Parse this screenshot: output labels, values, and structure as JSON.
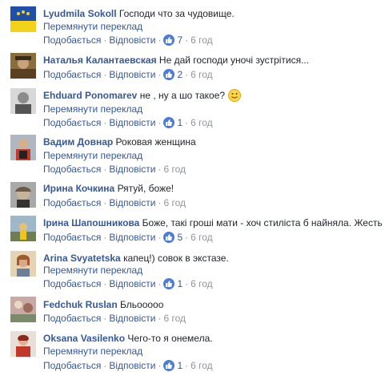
{
  "ui": {
    "like": "Подобається",
    "reply": "Відповісти",
    "translate": "Перемянути переклад",
    "dot": "·"
  },
  "comments": [
    {
      "author": "Lyudmila Sokoll",
      "text": "Господи что за чудовище.",
      "translate": "Перемянути переклад",
      "likes": "7",
      "time": "6 год"
    },
    {
      "author": "Наталья Калантаевская",
      "text": "Не дай господи уночі зустрітися...",
      "translate": "",
      "likes": "2",
      "time": "6 год"
    },
    {
      "author": "Ehduard Ponomarev",
      "text": "не , ну а шо такое?",
      "translate": "Перемянути переклад",
      "likes": "1",
      "time": "6 год"
    },
    {
      "author": "Вадим Довнар",
      "text": "Роковая женщина",
      "translate": "Перемянути переклад",
      "likes": "",
      "time": "6 год"
    },
    {
      "author": "Ирина Кочкина",
      "text": "Рятуй, боже!",
      "translate": "",
      "likes": "",
      "time": "6 год"
    },
    {
      "author": "Ірина Шапошникова",
      "text": "Боже, такі гроші мати - хоч стилiста б найняла. Жесть",
      "translate": "",
      "likes": "5",
      "time": "6 год"
    },
    {
      "author": "Arina Svyatetska",
      "text": "капец!) совок в экстазе.",
      "translate": "Перемянути переклад",
      "likes": "1",
      "time": "6 год"
    },
    {
      "author": "Fedchuk Ruslan",
      "text": "Бльооооо",
      "translate": "",
      "likes": "",
      "time": "6 год"
    },
    {
      "author": "Oksana Vasilenko",
      "text": "Чего-то я онемела.",
      "translate": "Перемянути переклад",
      "likes": "1",
      "time": "6 год"
    }
  ],
  "colors": {
    "link": "#365899",
    "meta": "#90949c",
    "like_badge": "#4c7bd9"
  }
}
